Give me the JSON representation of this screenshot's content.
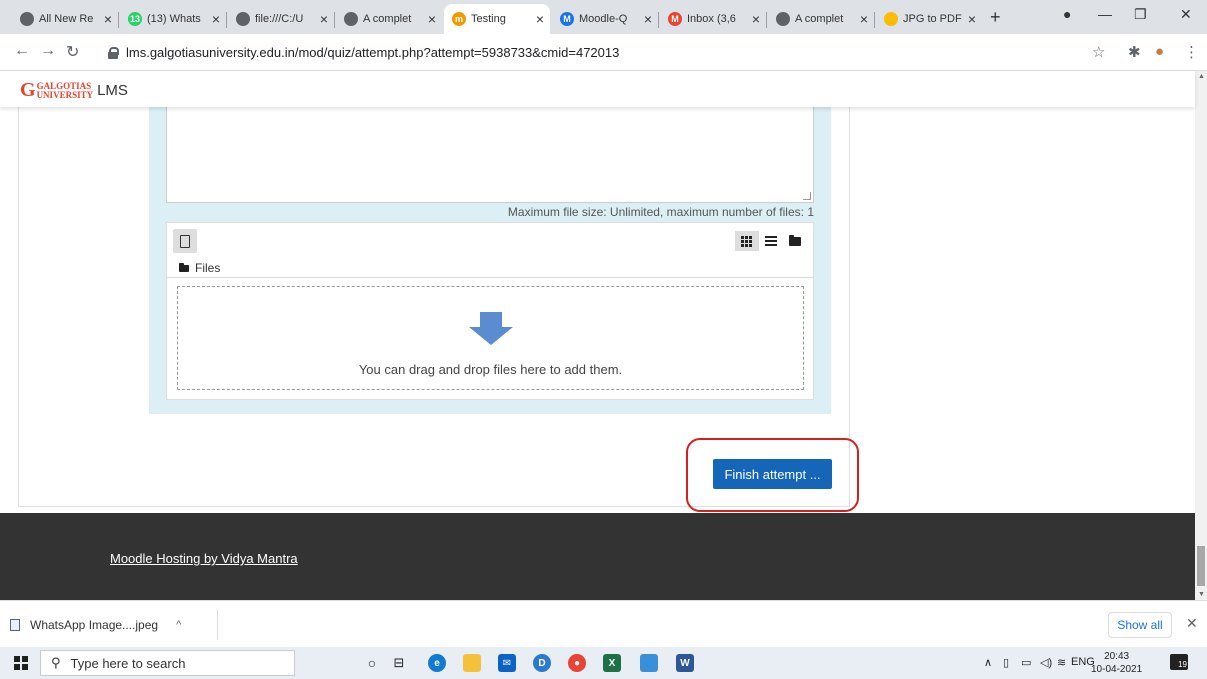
{
  "browser": {
    "tabs": [
      {
        "title": "All New Re",
        "color": "#5f6368",
        "fav": ""
      },
      {
        "title": "(13) Whats",
        "color": "#25d366",
        "fav": "13"
      },
      {
        "title": "file:///C:/U",
        "color": "#5f6368",
        "fav": ""
      },
      {
        "title": "A complet",
        "color": "#5f6368",
        "fav": ""
      },
      {
        "title": "Testing",
        "color": "#f29900",
        "fav": "m"
      },
      {
        "title": "Moodle-Q",
        "color": "#1a73e8",
        "fav": "M"
      },
      {
        "title": "Inbox (3,6",
        "color": "#ea4335",
        "fav": "M"
      },
      {
        "title": "A complet",
        "color": "#5f6368",
        "fav": ""
      },
      {
        "title": "JPG to PDF",
        "color": "#fbbc05",
        "fav": ""
      }
    ],
    "active_tab_index": 4,
    "new_tab": "+",
    "url": "lms.galgotiasuniversity.edu.in/mod/quiz/attempt.php?attempt=5938733&cmid=472013"
  },
  "site": {
    "logo_g": "G",
    "logo_name": "GALGOTIAS",
    "logo_sub": "UNIVERSITY",
    "logo_lms": "LMS"
  },
  "filemanager": {
    "max_size_text": "Maximum file size: Unlimited, maximum number of files: 1",
    "path_label": "Files",
    "drop_text": "You can drag and drop files here to add them."
  },
  "quiz": {
    "finish_label": "Finish attempt ..."
  },
  "footer": {
    "link_text": "Moodle Hosting by Vidya Mantra"
  },
  "downloads": {
    "file_name": "WhatsApp Image....jpeg",
    "show_all": "Show all"
  },
  "taskbar": {
    "search_placeholder": "Type here to search",
    "lang": "ENG",
    "time": "20:43",
    "date": "10-04-2021",
    "notifications": "19"
  },
  "colors": {
    "primary_button": "#1566b8",
    "highlight_ring": "#d61f1f",
    "footer_bg": "#333333",
    "answer_bg": "#dceff5"
  }
}
